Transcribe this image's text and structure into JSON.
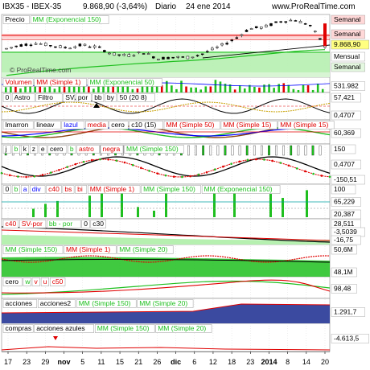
{
  "header": {
    "symbol": "IBX35 - IBEX-35",
    "last": "9.868,90 (-3,64%)",
    "period": "Diario",
    "date": "24 ene 2014",
    "site": "www.ProRealTime.com"
  },
  "watermark": "© ProRealTime.com",
  "chart_data": [
    {
      "type": "line",
      "panel": "price",
      "legend": [
        "Precio",
        "MM (Exponencial 150)"
      ],
      "right_labels": [
        "Semanal",
        "Semanal",
        "9.868,90",
        "Mensual",
        "Semanal"
      ],
      "x": [
        "17",
        "23",
        "29",
        "nov",
        "5",
        "11",
        "15",
        "21",
        "26",
        "dic",
        "6",
        "12",
        "18",
        "23",
        "2014",
        "8",
        "14",
        "20"
      ],
      "series": [
        {
          "name": "Precio",
          "values": [
            9800,
            9900,
            9950,
            9880,
            9820,
            9900,
            9840,
            9640,
            9600,
            9700,
            9520,
            9560,
            9550,
            9660,
            9850,
            10050,
            10350,
            10400,
            10550,
            10600,
            10450,
            9868.9
          ]
        },
        {
          "name": "MM (Exponencial 150)",
          "values": [
            9050,
            9100,
            9150,
            9190,
            9230,
            9270,
            9300,
            9330,
            9360,
            9390,
            9410,
            9440,
            9460,
            9490,
            9520,
            9560,
            9600,
            9640,
            9680,
            9720,
            9750,
            9770
          ]
        }
      ]
    },
    {
      "type": "bar",
      "panel": "volume",
      "legend": [
        "Volumen",
        "MM (Simple 1)",
        "MM (Exponencial 50)"
      ],
      "right_labels": [
        "531.982"
      ]
    },
    {
      "type": "line",
      "panel": "astro",
      "legend": [
        "0",
        "Astro",
        "Filtro",
        "SV",
        "por",
        "bb",
        "by",
        "50 (20 8)"
      ],
      "right_labels": [
        "57,421",
        "0,4707"
      ]
    },
    {
      "type": "line",
      "panel": "medias",
      "legend": [
        "lmarron",
        "lineav",
        "lazul",
        "media",
        "cero",
        "c10 (15)",
        "MM (Simple 50)",
        "MM (Simple 15)",
        "MM (Simple 15)"
      ],
      "right_labels": [
        "60,369"
      ]
    },
    {
      "type": "line",
      "panel": "astro-negra",
      "legend": [
        "j",
        "b",
        "k",
        "z",
        "e",
        "cero",
        "b",
        "astro",
        "negra",
        "MM (Simple 150)"
      ],
      "right_labels": [
        "150",
        "0,4707",
        "-150,51"
      ]
    },
    {
      "type": "bar",
      "panel": "c40",
      "legend": [
        "0",
        "b",
        "a",
        "div",
        "c40",
        "bs",
        "bi",
        "MM (Simple 1)",
        "MM (Simple 150)",
        "MM (Exponencial 150)"
      ],
      "right_labels": [
        "100",
        "65,229",
        "20,387"
      ]
    },
    {
      "type": "line",
      "panel": "sv-por",
      "legend": [
        "c40",
        "SV-por",
        "bb - por",
        "0",
        "c30"
      ],
      "right_labels": [
        "28,511",
        "-3,5039",
        "-16,75"
      ]
    },
    {
      "type": "area",
      "panel": "mm-area",
      "legend": [
        "MM (Simple 150)",
        "MM (Simple 1)",
        "MM (Simple 20)"
      ],
      "right_labels": [
        "50,6M",
        "48,1M"
      ]
    },
    {
      "type": "line",
      "panel": "cero-c50",
      "legend": [
        "cero",
        "w",
        "v",
        "u",
        "c50"
      ],
      "right_labels": [
        "98,48"
      ]
    },
    {
      "type": "area",
      "panel": "acciones",
      "legend": [
        "acciones",
        "acciones2",
        "MM (Simple 150)",
        "MM (Simple 20)"
      ],
      "right_labels": [
        "1.291,7"
      ]
    },
    {
      "type": "line",
      "panel": "compras",
      "legend": [
        "compras",
        "acciones azules",
        "MM (Simple 150)",
        "MM (Simple 20)"
      ],
      "right_labels": [
        "-4.613,5"
      ]
    }
  ],
  "colors": {
    "green": "#1fbf1f",
    "light_green_fill": "#b6f0b0",
    "red": "#e00000",
    "blue": "#0000ff",
    "navy_fill": "#3b4aa0",
    "gold": "#c8a000",
    "label_bg": "#ffffff"
  }
}
